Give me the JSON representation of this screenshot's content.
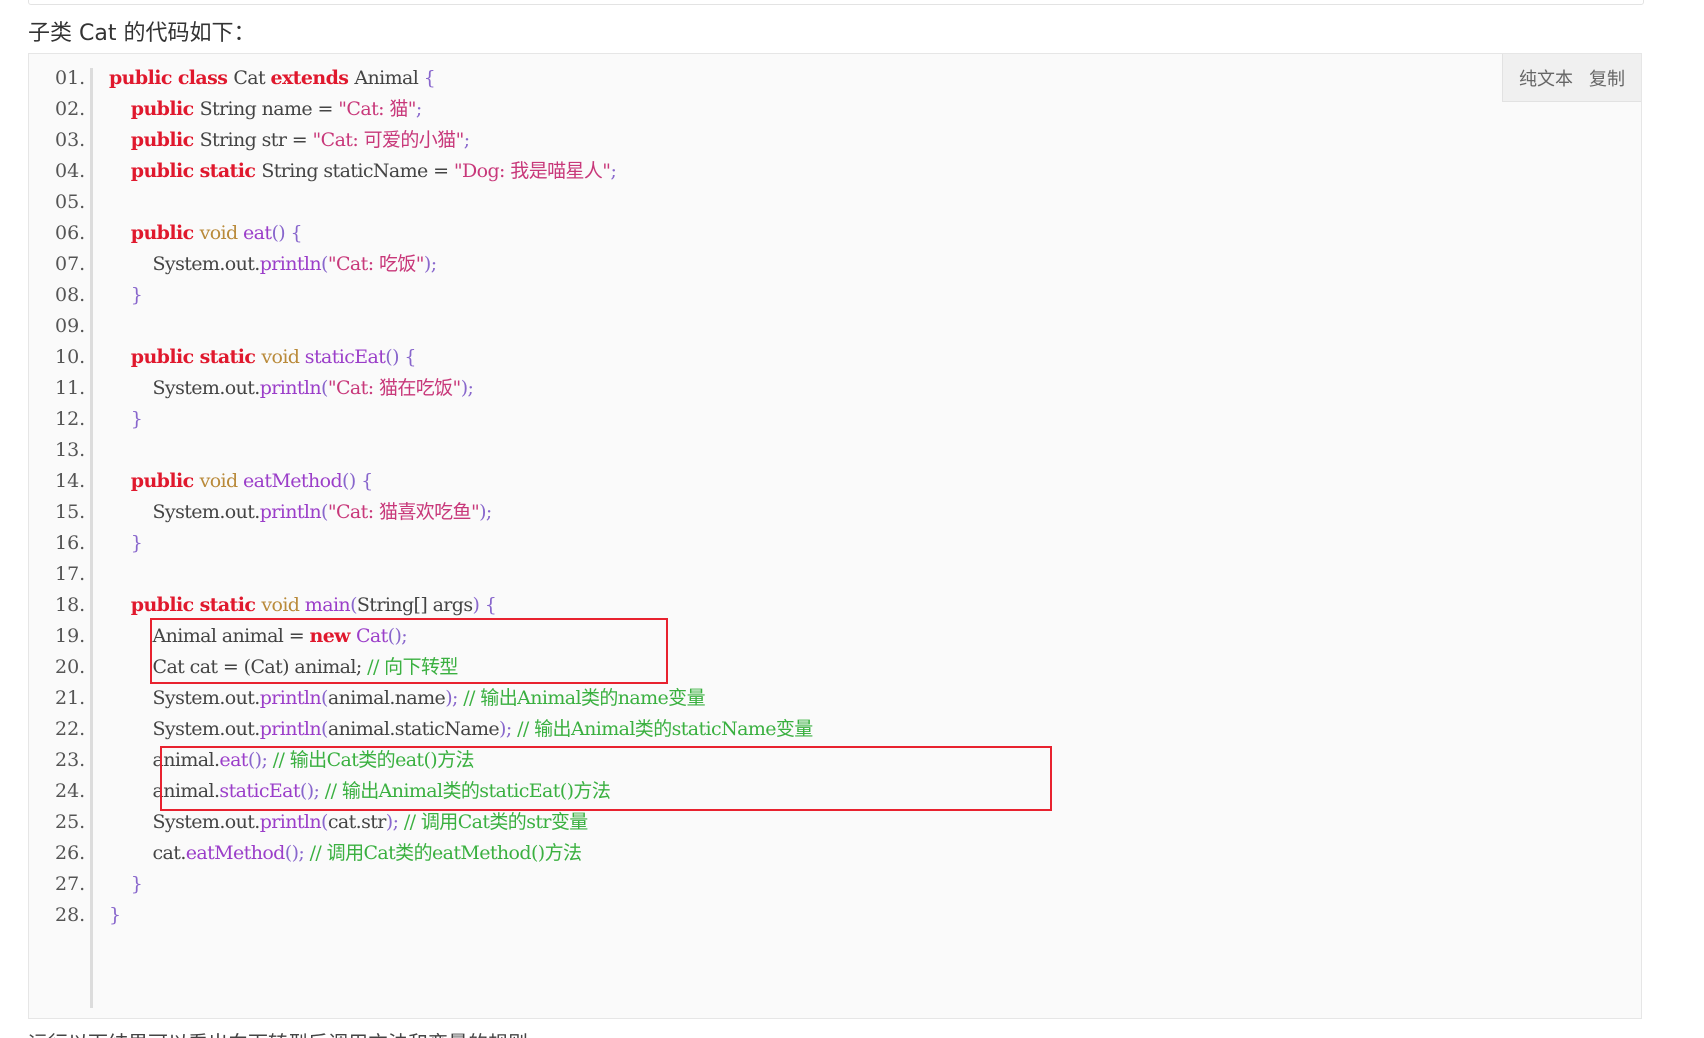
{
  "intro_text": "子类 Cat 的代码如下：",
  "toolbar": {
    "plain_text": "纯文本",
    "copy": "复制"
  },
  "colors": {
    "keyword": "#e0182d",
    "comment": "#3ab040",
    "function": "#9b3ec9",
    "string": "#c8387a",
    "highlight_border": "#e8222f"
  },
  "lines": [
    {
      "n": "01.",
      "tokens": [
        [
          "kw",
          "public "
        ],
        [
          "kw",
          "class "
        ],
        [
          "plain",
          "Cat "
        ],
        [
          "kw",
          "extends "
        ],
        [
          "plain",
          "Animal "
        ],
        [
          "punct",
          "{"
        ]
      ]
    },
    {
      "n": "02.",
      "tokens": [
        [
          "plain",
          "    "
        ],
        [
          "kw",
          "public "
        ],
        [
          "plain",
          "String name = "
        ],
        [
          "str",
          "\"Cat: 猫\""
        ],
        [
          "punct",
          ";"
        ]
      ]
    },
    {
      "n": "03.",
      "tokens": [
        [
          "plain",
          "    "
        ],
        [
          "kw",
          "public "
        ],
        [
          "plain",
          "String str = "
        ],
        [
          "str",
          "\"Cat: 可爱的小猫\""
        ],
        [
          "punct",
          ";"
        ]
      ]
    },
    {
      "n": "04.",
      "tokens": [
        [
          "plain",
          "    "
        ],
        [
          "kw",
          "public "
        ],
        [
          "kw",
          "static "
        ],
        [
          "plain",
          "String staticName = "
        ],
        [
          "str",
          "\"Dog: 我是喵星人\""
        ],
        [
          "punct",
          ";"
        ]
      ]
    },
    {
      "n": "05.",
      "tokens": []
    },
    {
      "n": "06.",
      "tokens": [
        [
          "plain",
          "    "
        ],
        [
          "kw",
          "public "
        ],
        [
          "type",
          "void "
        ],
        [
          "fn",
          "eat"
        ],
        [
          "punct",
          "() {"
        ]
      ]
    },
    {
      "n": "07.",
      "tokens": [
        [
          "plain",
          "        System.out."
        ],
        [
          "fn",
          "println"
        ],
        [
          "punct",
          "("
        ],
        [
          "str",
          "\"Cat: 吃饭\""
        ],
        [
          "punct",
          ");"
        ]
      ]
    },
    {
      "n": "08.",
      "tokens": [
        [
          "plain",
          "    "
        ],
        [
          "punct",
          "}"
        ]
      ]
    },
    {
      "n": "09.",
      "tokens": []
    },
    {
      "n": "10.",
      "tokens": [
        [
          "plain",
          "    "
        ],
        [
          "kw",
          "public "
        ],
        [
          "kw",
          "static "
        ],
        [
          "type",
          "void "
        ],
        [
          "fn",
          "staticEat"
        ],
        [
          "punct",
          "() {"
        ]
      ]
    },
    {
      "n": "11.",
      "tokens": [
        [
          "plain",
          "        System.out."
        ],
        [
          "fn",
          "println"
        ],
        [
          "punct",
          "("
        ],
        [
          "str",
          "\"Cat: 猫在吃饭\""
        ],
        [
          "punct",
          ");"
        ]
      ]
    },
    {
      "n": "12.",
      "tokens": [
        [
          "plain",
          "    "
        ],
        [
          "punct",
          "}"
        ]
      ]
    },
    {
      "n": "13.",
      "tokens": []
    },
    {
      "n": "14.",
      "tokens": [
        [
          "plain",
          "    "
        ],
        [
          "kw",
          "public "
        ],
        [
          "type",
          "void "
        ],
        [
          "fn",
          "eatMethod"
        ],
        [
          "punct",
          "() {"
        ]
      ]
    },
    {
      "n": "15.",
      "tokens": [
        [
          "plain",
          "        System.out."
        ],
        [
          "fn",
          "println"
        ],
        [
          "punct",
          "("
        ],
        [
          "str",
          "\"Cat: 猫喜欢吃鱼\""
        ],
        [
          "punct",
          ");"
        ]
      ]
    },
    {
      "n": "16.",
      "tokens": [
        [
          "plain",
          "    "
        ],
        [
          "punct",
          "}"
        ]
      ]
    },
    {
      "n": "17.",
      "tokens": []
    },
    {
      "n": "18.",
      "tokens": [
        [
          "plain",
          "    "
        ],
        [
          "kw",
          "public "
        ],
        [
          "kw",
          "static "
        ],
        [
          "type",
          "void "
        ],
        [
          "fn",
          "main"
        ],
        [
          "punct",
          "("
        ],
        [
          "plain",
          "String[] args"
        ],
        [
          "punct",
          ") {"
        ]
      ]
    },
    {
      "n": "19.",
      "tokens": [
        [
          "plain",
          "        Animal animal = "
        ],
        [
          "kw",
          "new "
        ],
        [
          "fn",
          "Cat"
        ],
        [
          "punct",
          "();"
        ]
      ]
    },
    {
      "n": "20.",
      "tokens": [
        [
          "plain",
          "        Cat cat = (Cat) animal; "
        ],
        [
          "comment",
          "// 向下转型"
        ]
      ]
    },
    {
      "n": "21.",
      "tokens": [
        [
          "plain",
          "        System.out."
        ],
        [
          "fn",
          "println"
        ],
        [
          "punct",
          "("
        ],
        [
          "plain",
          "animal.name"
        ],
        [
          "punct",
          ");"
        ],
        [
          "comment",
          " // 输出Animal类的name变量"
        ]
      ]
    },
    {
      "n": "22.",
      "tokens": [
        [
          "plain",
          "        System.out."
        ],
        [
          "fn",
          "println"
        ],
        [
          "punct",
          "("
        ],
        [
          "plain",
          "animal.staticName"
        ],
        [
          "punct",
          ");"
        ],
        [
          "comment",
          " // 输出Animal类的staticName变量"
        ]
      ]
    },
    {
      "n": "23.",
      "tokens": [
        [
          "plain",
          "        animal."
        ],
        [
          "fn",
          "eat"
        ],
        [
          "punct",
          "();"
        ],
        [
          "comment",
          " // 输出Cat类的eat()方法"
        ]
      ]
    },
    {
      "n": "24.",
      "tokens": [
        [
          "plain",
          "        animal."
        ],
        [
          "fn",
          "staticEat"
        ],
        [
          "punct",
          "();"
        ],
        [
          "comment",
          " // 输出Animal类的staticEat()方法"
        ]
      ]
    },
    {
      "n": "25.",
      "tokens": [
        [
          "plain",
          "        System.out."
        ],
        [
          "fn",
          "println"
        ],
        [
          "punct",
          "("
        ],
        [
          "plain",
          "cat.str"
        ],
        [
          "punct",
          ");"
        ],
        [
          "comment",
          " // 调用Cat类的str变量"
        ]
      ]
    },
    {
      "n": "26.",
      "tokens": [
        [
          "plain",
          "        cat."
        ],
        [
          "fn",
          "eatMethod"
        ],
        [
          "punct",
          "();"
        ],
        [
          "comment",
          " // 调用Cat类的eatMethod()方法"
        ]
      ]
    },
    {
      "n": "27.",
      "tokens": [
        [
          "plain",
          "    "
        ],
        [
          "punct",
          "}"
        ]
      ]
    },
    {
      "n": "28.",
      "tokens": [
        [
          "punct",
          "}"
        ]
      ]
    }
  ],
  "bottom_text": "运行以下结果可以看出向下转型后调用方法和变量的规则"
}
